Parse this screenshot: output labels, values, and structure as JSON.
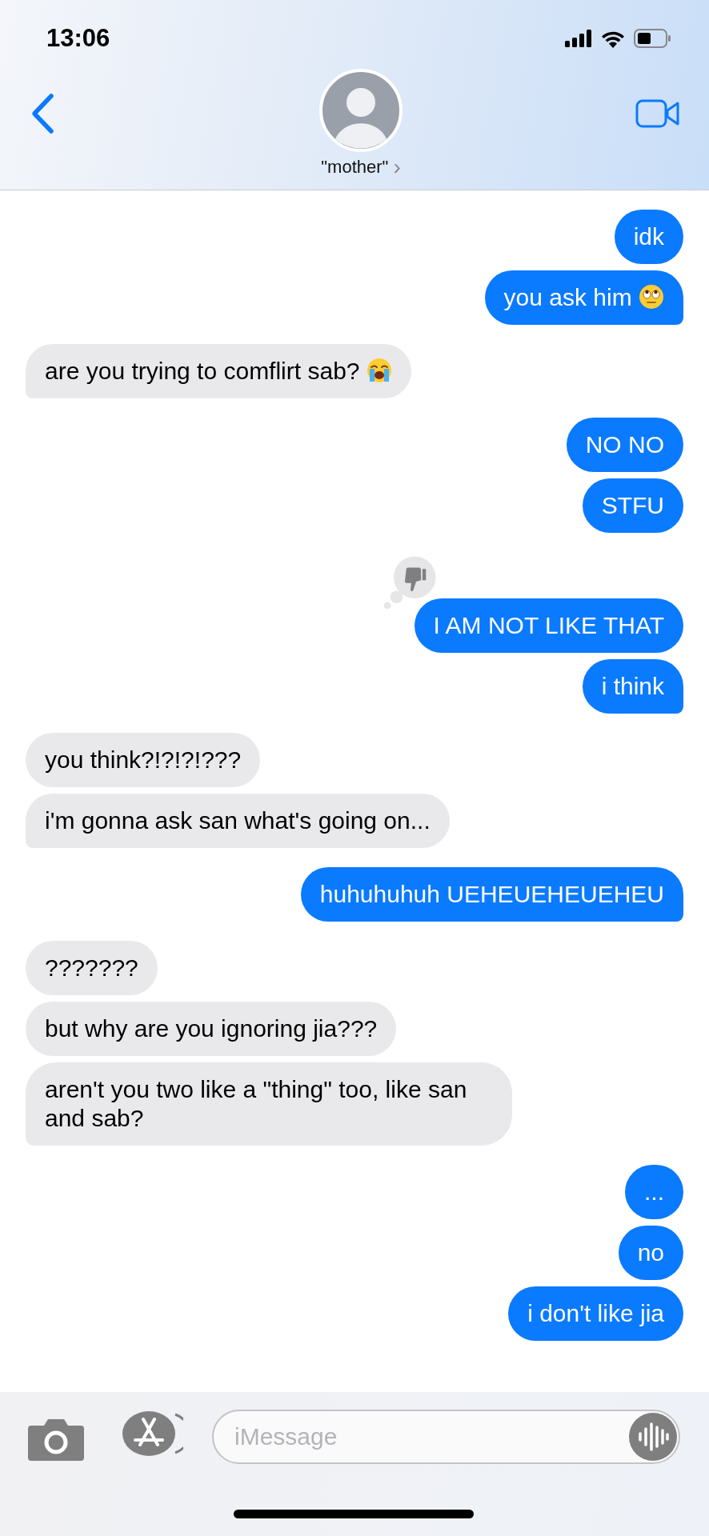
{
  "status_bar": {
    "time": "13:06"
  },
  "header": {
    "contact_name": "\"mother\"",
    "chevron": "›"
  },
  "messages": [
    {
      "kind": "sent",
      "text": "idk",
      "tail": false
    },
    {
      "kind": "sent",
      "text": "you ask him",
      "emoji": {
        "kind": "eyeroll"
      },
      "tail": true
    },
    {
      "kind": "received",
      "text": "are you trying to comflirt sab?",
      "emoji": {
        "kind": "crying"
      },
      "tail": true
    },
    {
      "kind": "sent",
      "text": "NO NO",
      "tail": false
    },
    {
      "kind": "sent",
      "text": "STFU",
      "tail": false
    },
    {
      "kind": "sent",
      "text": "I AM NOT LIKE THAT",
      "reaction": {
        "kind": "dislike"
      },
      "tail": false
    },
    {
      "kind": "sent",
      "text": "i think",
      "tail": true
    },
    {
      "kind": "received",
      "text": "you think?!?!?!???",
      "tail": false
    },
    {
      "kind": "received",
      "text": "i'm gonna ask san what's going on...",
      "tail": true
    },
    {
      "kind": "sent",
      "text": "huhuhuhuh UEHEUEHEUEHEU",
      "tail": true
    },
    {
      "kind": "received",
      "text": "???????",
      "tail": false
    },
    {
      "kind": "received",
      "text": "but why are you ignoring jia???",
      "tail": false
    },
    {
      "kind": "received",
      "text": "aren't you two like a \"thing\" too, like san and sab?",
      "tail": true
    },
    {
      "kind": "sent",
      "text": "...",
      "tail": false
    },
    {
      "kind": "sent",
      "text": "no",
      "tail": false
    },
    {
      "kind": "sent",
      "text": "i don't like jia",
      "tail": false
    }
  ],
  "composer": {
    "placeholder": "iMessage"
  }
}
